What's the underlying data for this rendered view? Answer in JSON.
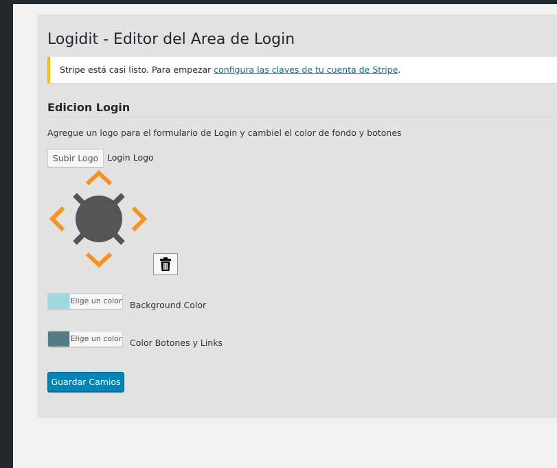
{
  "page": {
    "title": "Logidit - Editor del Area de Login"
  },
  "notice": {
    "text_before": "Stripe está casi listo. Para empezar ",
    "link_text": "configura las claves de tu cuenta de Stripe",
    "text_after": "."
  },
  "section": {
    "title": "Edicion Login",
    "description": "Agregue un logo para el formulario de Login y cambiel el color de fondo y botones"
  },
  "logo": {
    "upload_label": "Subir Logo",
    "label": "Login Logo"
  },
  "trash_icon": "trash-icon",
  "colors": {
    "accent_orange": "#f7941d",
    "logo_gray": "#555555",
    "background": {
      "button_text": "Elige un color",
      "label": "Background Color",
      "value": "#9fd8e0"
    },
    "buttons": {
      "button_text": "Elige un color",
      "label": "Color Botones y Links",
      "value": "#547c84"
    }
  },
  "submit": {
    "label": "Guardar Camios"
  }
}
